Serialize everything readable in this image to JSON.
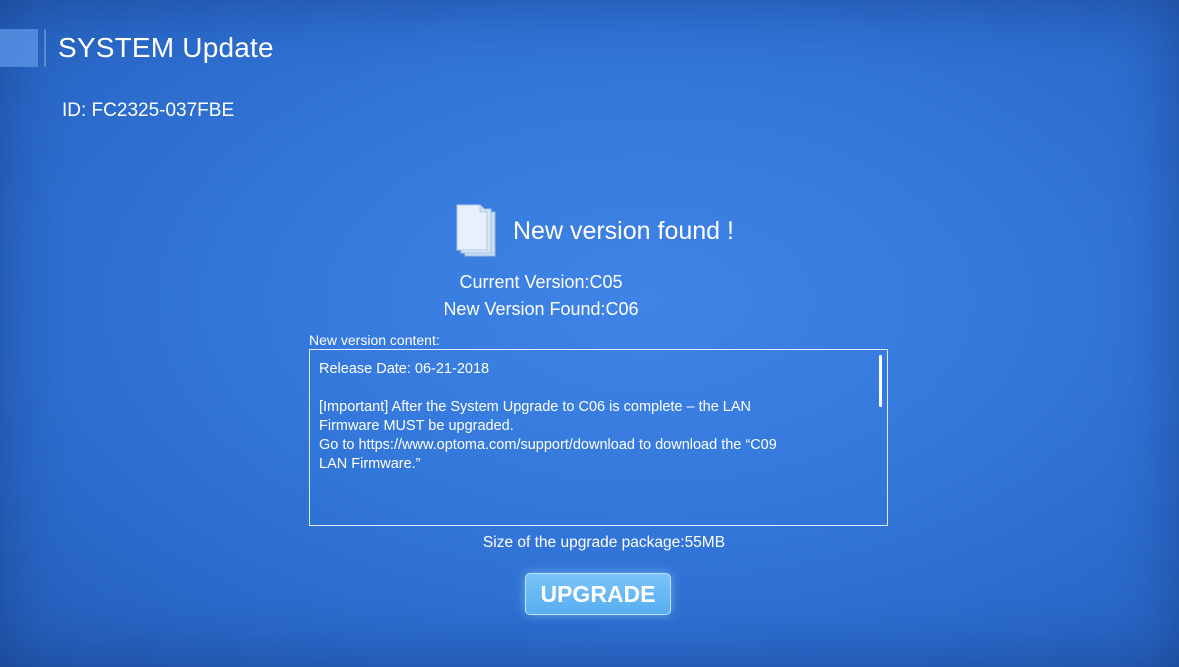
{
  "header": {
    "title": "SYSTEM Update",
    "device_id": "ID: FC2325-037FBE"
  },
  "update": {
    "found_message": "New version found !",
    "icon": "document-icon",
    "current_version": "Current Version:C05",
    "new_version": "New Version Found:C06",
    "content_label": "New version content:",
    "content_text": "Release Date: 06-21-2018\n\n[Important] After the System Upgrade to C06 is complete – the LAN\nFirmware MUST be upgraded.\nGo to https://www.optoma.com/support/download to download the “C09\nLAN Firmware.”",
    "package_size": "Size of the upgrade package:55MB",
    "upgrade_label": "UPGRADE"
  },
  "colors": {
    "background": "#3478dc",
    "button": "#62b4f2",
    "text": "#ffffff"
  }
}
